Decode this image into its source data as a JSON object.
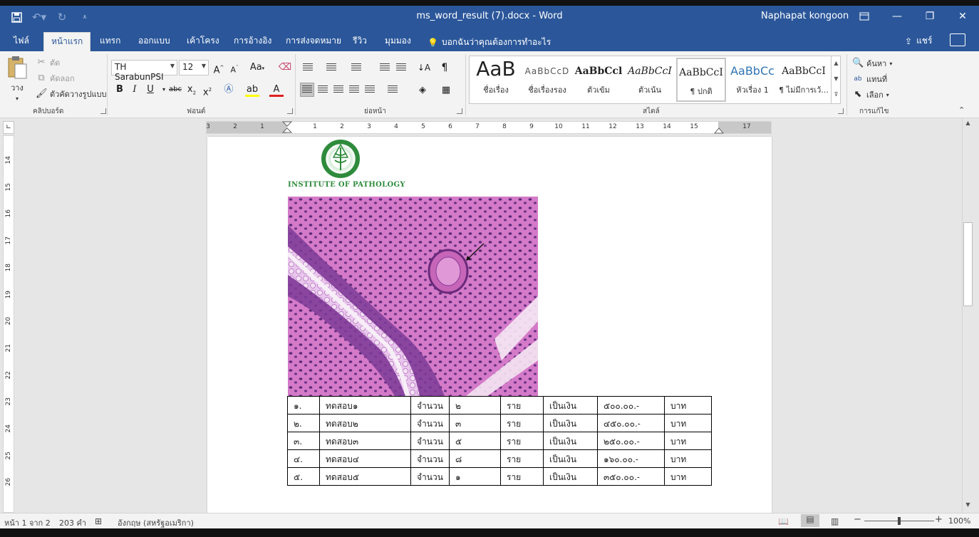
{
  "window": {
    "title": "ms_word_result (7).docx  -  Word",
    "user": "Naphapat kongoon",
    "accent": "#2b579a"
  },
  "qat": {
    "undo_icon": "undo-icon",
    "redo_icon": "redo-icon",
    "save_icon": "save-icon"
  },
  "tabs": [
    "ไฟล์",
    "หน้าแรก",
    "แทรก",
    "ออกแบบ",
    "เค้าโครง",
    "การอ้างอิง",
    "การส่งจดหมาย",
    "รีวิว",
    "มุมมอง"
  ],
  "tell_me": "บอกฉันว่าคุณต้องการทำอะไร",
  "share": "แชร์",
  "clipboard": {
    "paste": "วาง",
    "cut": "ตัด",
    "copy": "คัดลอก",
    "format_painter": "ตัวคัดวางรูปแบบ",
    "label": "คลิปบอร์ด"
  },
  "font": {
    "name": "TH SarabunPSI",
    "size": "12",
    "label": "ฟอนต์",
    "case_label": "Aa"
  },
  "paragraph": {
    "label": "ย่อหน้า"
  },
  "styles": {
    "label": "สไตล์",
    "items": [
      {
        "sample": "AaB",
        "name": "ชื่อเรื่อง"
      },
      {
        "sample": "AaBbCcD",
        "name": "ชื่อเรื่องรอง"
      },
      {
        "sample": "AaBbCcl",
        "name": "ตัวเข้ม"
      },
      {
        "sample": "AaBbCcI",
        "name": "ตัวเน้น"
      },
      {
        "sample": "AaBbCcI",
        "name": "¶ ปกติ"
      },
      {
        "sample": "AaBbCc",
        "name": "หัวเรื่อง 1"
      },
      {
        "sample": "AaBbCcI",
        "name": "¶ ไม่มีการเว้..."
      }
    ]
  },
  "editing": {
    "find": "ค้นหา",
    "replace": "แทนที่",
    "select": "เลือก",
    "label": "การแก้ไข"
  },
  "ruler": {
    "h_labels": [
      "3",
      "2",
      "1",
      "1",
      "2",
      "3",
      "4",
      "5",
      "6",
      "7",
      "8",
      "9",
      "10",
      "11",
      "12",
      "13",
      "14",
      "15",
      "17"
    ],
    "v_labels": [
      "14",
      "15",
      "16",
      "17",
      "18",
      "19",
      "20",
      "21",
      "22",
      "23",
      "24",
      "25",
      "26"
    ]
  },
  "document": {
    "logo_text": "INSTITUTE OF PATHOLOGY",
    "table": [
      [
        "๑.",
        "ทดสอบ๑",
        "จำนวน",
        "๒",
        "ราย",
        "เป็นเงิน",
        "๕๐๐.๐๐.-",
        "บาท"
      ],
      [
        "๒.",
        "ทดสอบ๒",
        "จำนวน",
        "๓",
        "ราย",
        "เป็นเงิน",
        "๔๕๐.๐๐.-",
        "บาท"
      ],
      [
        "๓.",
        "ทดสอบ๓",
        "จำนวน",
        "๕",
        "ราย",
        "เป็นเงิน",
        "๒๕๐.๐๐.-",
        "บาท"
      ],
      [
        "๔.",
        "ทดสอบ๔",
        "จำนวน",
        "๘",
        "ราย",
        "เป็นเงิน",
        "๑๖๐.๐๐.-",
        "บาท"
      ],
      [
        "๕.",
        "ทดสอบ๕",
        "จำนวน",
        "๑",
        "ราย",
        "เป็นเงิน",
        "๓๕๐.๐๐.-",
        "บาท"
      ]
    ]
  },
  "status": {
    "page": "หน้า 1 จาก 2",
    "words": "203 คำ",
    "language": "อังกฤษ (สหรัฐอเมริกา)",
    "zoom": "100%",
    "zoom_fraction": 0.5
  }
}
